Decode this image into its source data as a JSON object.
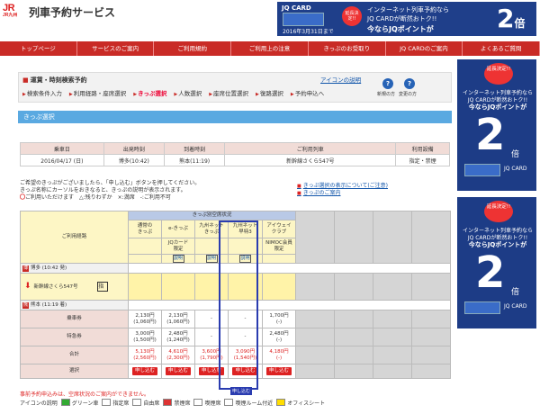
{
  "header": {
    "logo_text": "JR",
    "logo_sub": "JR九州",
    "site_title": "列車予約サービス"
  },
  "top_banner": {
    "jq": "JQ CARD",
    "badge": "延長決定!!",
    "date": "2016年3月31日まで",
    "line1": "インターネット列車予約なら",
    "line2": "JQ CARDが断然おトク!!",
    "line3": "今ならJQポイントが",
    "big": "2",
    "bai": "倍"
  },
  "nav": [
    "トップページ",
    "サービスのご案内",
    "ご利用規約",
    "ご利用上の注意",
    "きっぷのお受取り",
    "JQ CARDのご案内",
    "よくあるご質問"
  ],
  "panel": {
    "title": "運賃・時刻検索予約",
    "help_link": "アイコンの説明",
    "steps": [
      "検索条件入力",
      "利用経路・座席選択",
      "きっぷ選択",
      "人数選択",
      "座席位置選択",
      "復路選択",
      "予約申込へ"
    ],
    "current_step": 2,
    "btn1_label": "新規の方",
    "btn2_label": "変更の方"
  },
  "section_title": "きっぷ選択",
  "trip_info": {
    "headers": [
      "乗車日",
      "出発時刻",
      "到着時刻",
      "ご利用列車",
      "利用設備"
    ],
    "values": [
      "2016/04/17 (日)",
      "博多(10:42)",
      "熊本(11:19)",
      "新幹線さくら547号",
      "指定・禁煙"
    ]
  },
  "notes": {
    "line1": "ご希望のきっぷがございましたら、「申し込む」ボタンを押してください。",
    "line2": "きっぷ名称にカーソルをおきなると、きっぷの説明が表示されます。",
    "legend_mark": "〇",
    "legend_rest": "ご利用いただけます　△:残りわずか　×:満席　-:ご利用不可"
  },
  "links": [
    "きっぷ選択の表示について(ご注意)",
    "きっぷのご案内"
  ],
  "grid": {
    "route_header": "ご利用経路",
    "seat_caption": "きっぷ別空席状況",
    "tickets": [
      {
        "name": "通常の\nきっぷ",
        "note": "",
        "link": ""
      },
      {
        "name": "e-きっぷ",
        "note": "JQカード\n限定",
        "link": "説明"
      },
      {
        "name": "九州ネット\nきっぷ",
        "note": "",
        "link": "説明"
      },
      {
        "name": "九州ネット\n早特3",
        "note": "",
        "link": "説明"
      },
      {
        "name": "アイウェイ\nクラブ",
        "note": "NIMOC会員\n限定",
        "link": "説明"
      }
    ],
    "from_station": "博多 (10:42 発)",
    "train": "新幹線さくら547号",
    "train_mark": "指",
    "to_station": "熊本 (11:19 着)",
    "from_icon": "博",
    "to_icon": "熊",
    "rows": [
      {
        "label": "乗車券",
        "cells": [
          "2,130円\n(1,060円)",
          "2,130円\n(1,060円)",
          "-",
          "-",
          "1,700円\n(-)"
        ]
      },
      {
        "label": "特急券",
        "cells": [
          "3,000円\n(1,500円)",
          "2,480円\n(1,240円)",
          "-",
          "-",
          "2,480円\n(-)"
        ]
      },
      {
        "label": "合計",
        "cells": [
          "5,130円\n(2,560円)",
          "4,610円\n(2,300円)",
          "3,600円\n(1,790円)",
          "3,090円\n(1,540円)",
          "4,180円\n(-)"
        ]
      }
    ],
    "select_label": "選択",
    "apply_label": "申し込む"
  },
  "tooltip": "申し込む",
  "footer": {
    "note": "事前予約申込みは、空席状況のご案内ができません。",
    "legend_intro": "アイコンの説明",
    "legend": [
      "グリーン車",
      "指定席",
      "自由席",
      "禁煙席",
      "喫煙席",
      "喫煙ルーム付近",
      "オフィスシート"
    ]
  },
  "side_banner": {
    "badge": "延長決定!!",
    "date": "2016年3月31日まで",
    "line1": "インターネット列車予約なら",
    "line2": "JQ CARDが断然おトク!!",
    "line3": "今ならJQポイントが",
    "big": "2",
    "bai": "倍",
    "jq": "JQ CARD"
  }
}
